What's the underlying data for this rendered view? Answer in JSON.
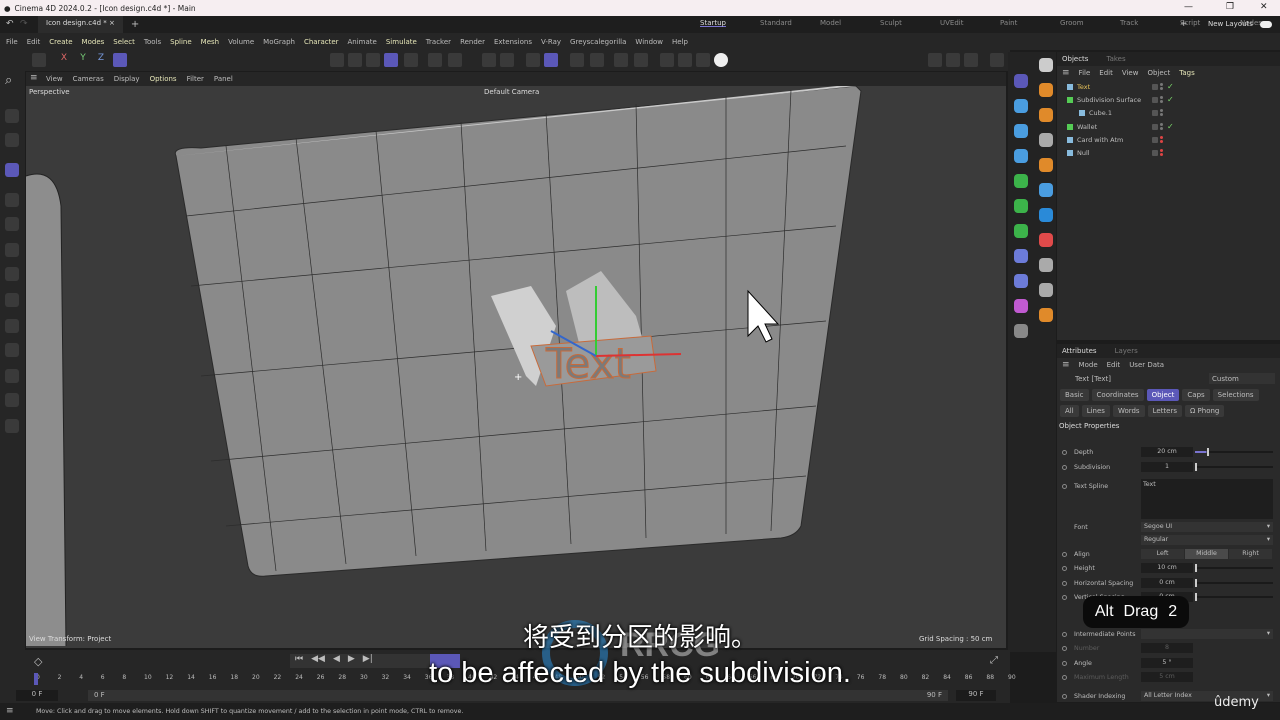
{
  "window": {
    "title": "Cinema 4D 2024.0.2 - [Icon design.c4d *] - Main",
    "minimize": "—",
    "restore": "❐",
    "close": "✕"
  },
  "tabs": {
    "doc": "Icon design.c4d *",
    "close": "×",
    "add": "+"
  },
  "layouts": {
    "items": [
      "Startup",
      "Standard",
      "Model",
      "Sculpt",
      "UVEdit",
      "Paint",
      "Groom",
      "Track",
      "Script",
      "Nodes"
    ],
    "add": "+",
    "new_layouts": "New Layouts"
  },
  "menu": [
    "File",
    "Edit",
    "Create",
    "Modes",
    "Select",
    "Tools",
    "Spline",
    "Mesh",
    "Volume",
    "MoGraph",
    "Character",
    "Animate",
    "Simulate",
    "Tracker",
    "Render",
    "Extensions",
    "V-Ray",
    "Greyscalegorilla",
    "Window",
    "Help"
  ],
  "axis": {
    "x": "X",
    "y": "Y",
    "z": "Z"
  },
  "viewport": {
    "menu": [
      "View",
      "Cameras",
      "Display",
      "Options",
      "Filter",
      "Panel"
    ],
    "name": "Perspective",
    "camera": "Default Camera",
    "view_transform": "View Transform: Project",
    "grid_spacing": "Grid Spacing : 50 cm",
    "text_object": "Text"
  },
  "objects": {
    "tabs": [
      "Objects",
      "Takes"
    ],
    "menu": [
      "File",
      "Edit",
      "View",
      "Object",
      "Tags"
    ],
    "items": [
      {
        "name": "Text",
        "selected": true,
        "check": true
      },
      {
        "name": "Subdivision Surface",
        "check": true
      },
      {
        "name": "Cube.1",
        "check": false
      },
      {
        "name": "Wallet",
        "check": true
      },
      {
        "name": "Card with Atm",
        "check": false
      },
      {
        "name": "Null",
        "check": false
      }
    ]
  },
  "attributes": {
    "tabs": [
      "Attributes",
      "Layers"
    ],
    "menu": [
      "Mode",
      "Edit",
      "User Data"
    ],
    "object": "Text [Text]",
    "preset": "Custom",
    "tabs_row1": [
      "Basic",
      "Coordinates",
      "Object",
      "Caps",
      "Selections"
    ],
    "tabs_row2": [
      "All",
      "Lines",
      "Words",
      "Letters",
      "Ω Phong"
    ],
    "active_tab": "Object",
    "section": "Object Properties",
    "depth": {
      "label": "Depth",
      "value": "20 cm",
      "slider": 0.15
    },
    "subdivision": {
      "label": "Subdivision",
      "value": "1",
      "slider": 0.0
    },
    "text_spline": {
      "label": "Text Spline",
      "value": "Text"
    },
    "font": {
      "label": "Font",
      "family": "Segoe UI",
      "style": "Regular"
    },
    "align": {
      "label": "Align",
      "options": [
        "Left",
        "Middle",
        "Right"
      ],
      "selected": "Middle"
    },
    "height": {
      "label": "Height",
      "value": "10 cm"
    },
    "hspacing": {
      "label": "Horizontal Spacing",
      "value": "0 cm"
    },
    "vspacing": {
      "label": "Vertical Spacing",
      "value": "0 cm"
    },
    "intermediate": {
      "label": "Intermediate Points"
    },
    "number": {
      "label": "Number",
      "value": "8"
    },
    "angle": {
      "label": "Angle",
      "value": "5 °"
    },
    "maxlen": {
      "label": "Maximum Length",
      "value": "5 cm"
    },
    "shader": {
      "label": "Shader Indexing",
      "value": "All Letter Index"
    }
  },
  "timeline": {
    "ticks": [
      "0",
      "2",
      "4",
      "6",
      "8",
      "10",
      "12",
      "14",
      "16",
      "18",
      "20",
      "22",
      "24",
      "26",
      "28",
      "30",
      "32",
      "34",
      "36",
      "38",
      "40",
      "42",
      "44",
      "46",
      "48",
      "50",
      "52",
      "54",
      "56",
      "58",
      "60",
      "62",
      "64",
      "66",
      "68",
      "70",
      "72",
      "74",
      "76",
      "78",
      "80",
      "82",
      "84",
      "86",
      "88",
      "90"
    ],
    "start": "0 F",
    "range_start": "0 F",
    "range_end": "90 F",
    "end": "90 F"
  },
  "status": "Move: Click and drag to move elements. Hold down SHIFT to quantize movement / add to the selection in point mode, CTRL to remove.",
  "overlay": {
    "subtitle_cn": "将受到分区的影响。",
    "subtitle_en": "to be affected by the subdivision.",
    "key_hint": [
      "Alt",
      "Drag",
      "2"
    ],
    "watermark": "RRCG 人人素材",
    "brand": "ûdemy"
  },
  "colors": {
    "accent": "#5b58b8",
    "check": "#7bd96b",
    "selected_text": "#e8c35a"
  }
}
